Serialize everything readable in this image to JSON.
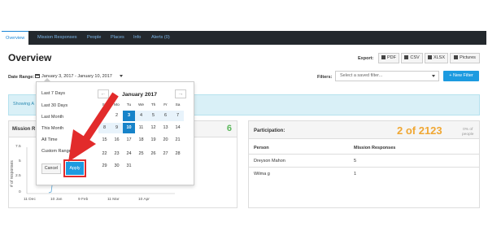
{
  "nav": {
    "tabs": [
      {
        "label": "Overview"
      },
      {
        "label": "Mission Responses"
      },
      {
        "label": "People"
      },
      {
        "label": "Places"
      },
      {
        "label": "Info"
      },
      {
        "label": "Alerts (0)"
      }
    ]
  },
  "page": {
    "title": "Overview"
  },
  "export": {
    "label": "Export:",
    "buttons": [
      {
        "label": "PDF",
        "icon": "pdf-file-icon"
      },
      {
        "label": "CSV",
        "icon": "csv-file-icon"
      },
      {
        "label": "XLSX",
        "icon": "xlsx-file-icon"
      },
      {
        "label": "Pictures",
        "icon": "picture-icon"
      }
    ]
  },
  "date_range": {
    "label": "Date Range:",
    "value": "January 3, 2017 - January 10, 2017"
  },
  "filters": {
    "label": "Filters:",
    "placeholder": "Select a saved filter...",
    "new_filter": "+ New Filter"
  },
  "info_bar": {
    "text": "Showing A"
  },
  "mission_panel": {
    "title": "Mission R",
    "count": "6",
    "y_ticks": [
      "7.5",
      "5",
      "2.5",
      "0"
    ],
    "x_ticks": [
      "11 Dec",
      "10 Jan",
      "9 Feb",
      "11 Mar",
      "10 Apr"
    ],
    "y_label": "# of responses"
  },
  "participation": {
    "title": "Participation:",
    "count": "2 of 2123",
    "percent": "0% of",
    "percent_sub": "people",
    "columns": [
      "Person",
      "Mission Responses"
    ],
    "rows": [
      {
        "person": "Dreyson Mahon",
        "responses": "5"
      },
      {
        "person": "Wilma g",
        "responses": "1"
      }
    ]
  },
  "datepicker": {
    "ranges": [
      "Last 7 Days",
      "Last 30 Days",
      "Last Month",
      "This Month",
      "All Time",
      "Custom Range"
    ],
    "cancel": "Cancel",
    "apply": "Apply",
    "prev": "←",
    "next": "→",
    "month": "January 2017",
    "weekdays": [
      "Su",
      "Mo",
      "Tu",
      "We",
      "Th",
      "Fr",
      "Sa"
    ],
    "weeks": [
      [
        "1",
        "2",
        "3",
        "4",
        "5",
        "6",
        "7"
      ],
      [
        "8",
        "9",
        "10",
        "11",
        "12",
        "13",
        "14"
      ],
      [
        "15",
        "16",
        "17",
        "18",
        "19",
        "20",
        "21"
      ],
      [
        "22",
        "23",
        "24",
        "25",
        "26",
        "27",
        "28"
      ],
      [
        "29",
        "30",
        "31",
        "",
        "",
        "",
        ""
      ]
    ],
    "selected_start": "3",
    "selected_end": "10"
  },
  "colors": {
    "accent": "#1d9be0",
    "selected_day": "#1783c9",
    "green_count": "#5cb85c",
    "orange_count": "#f0a733",
    "annotation_red": "#e22b2b",
    "nav_bg": "#23282d"
  }
}
